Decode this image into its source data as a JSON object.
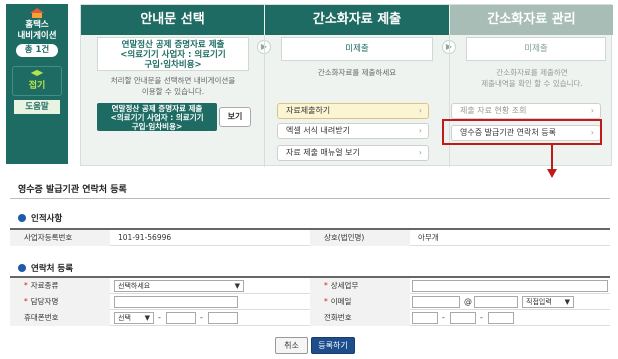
{
  "left_panel": {
    "title_line1": "홈택스",
    "title_line2": "내비게이션",
    "count": "총 1건",
    "fold_arrow": "◀▶",
    "fold_label": "접기",
    "help": "도움말",
    "brand_color": "#1e6b63"
  },
  "columns": [
    {
      "header": "안내문 선택",
      "desc_line1": "연말정산 공제 증명자료 제출",
      "desc_line2": "<의료기기 사업자 : 의료기기",
      "desc_line3": "구입·임차비용>",
      "info_line1": "처리할 안내문을 선택하면 내비게이션을",
      "info_line2": "이용할 수 있습니다.",
      "selected_line1": "연말정산 공제 증명자료 제출",
      "selected_line2": "<의료기기 사업자 : 의료기기",
      "selected_line3": "구입·임차비용>",
      "view_button": "보기"
    },
    {
      "header": "간소화자료 제출",
      "status": "미제출",
      "info": "간소화자료를 제출하세요",
      "menu": [
        "자료제출하기",
        "엑셀 서식 내려받기",
        "자료 제출 매뉴얼 보기"
      ]
    },
    {
      "header": "간소화자료 관리",
      "status": "미제출",
      "info_line1": "간소화자료를 제출하면",
      "info_line2": "제출내역을 확인 할 수 있습니다.",
      "menu": [
        "제출 자료 현황 조회",
        "영수증 발급기관 연락처 등록"
      ]
    }
  ],
  "form": {
    "title": "영수증 발급기관 연락처 등록",
    "section_person": "인적사항",
    "biz_no_label": "사업자등록번호",
    "biz_no_value": "101-91-56996",
    "company_label": "상호(법인명)",
    "company_value": "아무개",
    "section_contact": "연락처 등록",
    "data_type_label": "자료종류",
    "data_type_value": "선택하세요",
    "detail_label": "상세업무",
    "manager_label": "담당자명",
    "email_label": "이메일",
    "email_at": "@",
    "email_domain_value": "직접입력",
    "mobile_label": "휴대폰번호",
    "mobile_select_value": "선택",
    "phone_label": "전화번호",
    "dash": "-",
    "required_mark": "*",
    "cancel_button": "취소",
    "submit_button": "등록하기"
  },
  "colors": {
    "highlight": "#c01b1b",
    "submit": "#1e4d8c",
    "section_dot": "#1e5aa8"
  },
  "chevron": "›"
}
